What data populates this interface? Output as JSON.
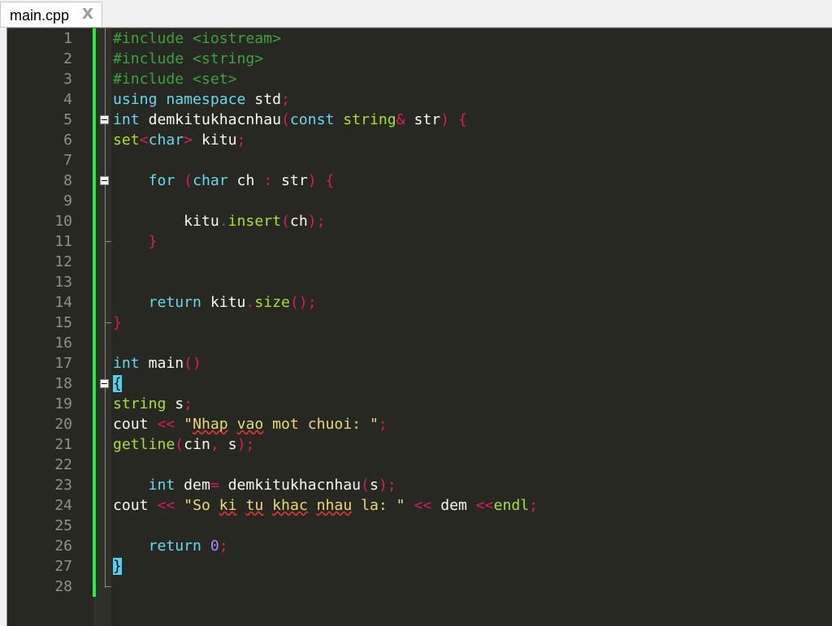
{
  "tab": {
    "title": "main.cpp",
    "close_glyph": "X"
  },
  "theme": {
    "background": "#272822",
    "line_number": "#8f908a",
    "change_bar": "#22ee44"
  },
  "lines": [
    {
      "n": "1",
      "tokens": [
        [
          "pre",
          "#include <iostream>"
        ]
      ]
    },
    {
      "n": "2",
      "tokens": [
        [
          "pre",
          "#include <string>"
        ]
      ]
    },
    {
      "n": "3",
      "tokens": [
        [
          "pre",
          "#include <set>"
        ]
      ]
    },
    {
      "n": "4",
      "tokens": [
        [
          "kw",
          "using namespace"
        ],
        [
          "id",
          " std"
        ],
        [
          "op",
          ";"
        ]
      ]
    },
    {
      "n": "5",
      "fold": true,
      "tokens": [
        [
          "kw",
          "int"
        ],
        [
          "id",
          " demkitukhacnhau"
        ],
        [
          "op",
          "("
        ],
        [
          "kw",
          "const"
        ],
        [
          "id",
          " "
        ],
        [
          "fn",
          "string"
        ],
        [
          "op",
          "&"
        ],
        [
          "id",
          " str"
        ],
        [
          "op",
          ")"
        ],
        [
          "id",
          " "
        ],
        [
          "op",
          "{"
        ]
      ]
    },
    {
      "n": "6",
      "tokens": [
        [
          "fn",
          "set"
        ],
        [
          "op",
          "<"
        ],
        [
          "kw",
          "char"
        ],
        [
          "op",
          ">"
        ],
        [
          "id",
          " kitu"
        ],
        [
          "op",
          ";"
        ]
      ]
    },
    {
      "n": "7",
      "tokens": []
    },
    {
      "n": "8",
      "fold": true,
      "tokens": [
        [
          "id",
          "    "
        ],
        [
          "kw",
          "for"
        ],
        [
          "id",
          " "
        ],
        [
          "op",
          "("
        ],
        [
          "kw",
          "char"
        ],
        [
          "id",
          " ch "
        ],
        [
          "op",
          ":"
        ],
        [
          "id",
          " str"
        ],
        [
          "op",
          ")"
        ],
        [
          "id",
          " "
        ],
        [
          "op",
          "{"
        ]
      ]
    },
    {
      "n": "9",
      "tokens": []
    },
    {
      "n": "10",
      "tokens": [
        [
          "id",
          "        kitu"
        ],
        [
          "op",
          "."
        ],
        [
          "fn",
          "insert"
        ],
        [
          "op",
          "("
        ],
        [
          "id",
          "ch"
        ],
        [
          "op",
          ")"
        ],
        [
          "op",
          ";"
        ]
      ]
    },
    {
      "n": "11",
      "foldend": true,
      "tokens": [
        [
          "id",
          "    "
        ],
        [
          "op",
          "}"
        ]
      ]
    },
    {
      "n": "12",
      "tokens": []
    },
    {
      "n": "13",
      "tokens": []
    },
    {
      "n": "14",
      "tokens": [
        [
          "id",
          "    "
        ],
        [
          "kw",
          "return"
        ],
        [
          "id",
          " kitu"
        ],
        [
          "op",
          "."
        ],
        [
          "fn",
          "size"
        ],
        [
          "op",
          "()"
        ],
        [
          "op",
          ";"
        ]
      ]
    },
    {
      "n": "15",
      "foldend": true,
      "tokens": [
        [
          "op",
          "}"
        ]
      ]
    },
    {
      "n": "16",
      "tokens": []
    },
    {
      "n": "17",
      "tokens": [
        [
          "kw",
          "int"
        ],
        [
          "id",
          " main"
        ],
        [
          "op",
          "()"
        ]
      ]
    },
    {
      "n": "18",
      "fold": true,
      "tokens": [
        [
          "brace",
          "{"
        ]
      ]
    },
    {
      "n": "19",
      "tokens": [
        [
          "fn",
          "string"
        ],
        [
          "id",
          " s"
        ],
        [
          "op",
          ";"
        ]
      ]
    },
    {
      "n": "20",
      "tokens": [
        [
          "id",
          "cout "
        ],
        [
          "op",
          "<<"
        ],
        [
          "id",
          " "
        ],
        [
          "str",
          "\""
        ],
        [
          "strsq",
          "Nhap"
        ],
        [
          "str",
          " "
        ],
        [
          "strsq",
          "vao"
        ],
        [
          "str",
          " mot chuoi: \""
        ],
        [
          "op",
          ";"
        ]
      ]
    },
    {
      "n": "21",
      "tokens": [
        [
          "fn",
          "getline"
        ],
        [
          "op",
          "("
        ],
        [
          "id",
          "cin"
        ],
        [
          "op",
          ","
        ],
        [
          "id",
          " s"
        ],
        [
          "op",
          ")"
        ],
        [
          "op",
          ";"
        ]
      ]
    },
    {
      "n": "22",
      "tokens": []
    },
    {
      "n": "23",
      "tokens": [
        [
          "id",
          "    "
        ],
        [
          "kw",
          "int"
        ],
        [
          "id",
          " dem"
        ],
        [
          "op",
          "="
        ],
        [
          "id",
          " demkitukhacnhau"
        ],
        [
          "op",
          "("
        ],
        [
          "id",
          "s"
        ],
        [
          "op",
          ")"
        ],
        [
          "op",
          ";"
        ]
      ]
    },
    {
      "n": "24",
      "tokens": [
        [
          "id",
          "cout "
        ],
        [
          "op",
          "<<"
        ],
        [
          "id",
          " "
        ],
        [
          "str",
          "\"So "
        ],
        [
          "strsq",
          "ki"
        ],
        [
          "str",
          " "
        ],
        [
          "strsq",
          "tu"
        ],
        [
          "str",
          " "
        ],
        [
          "strsq",
          "khac"
        ],
        [
          "str",
          " "
        ],
        [
          "strsq",
          "nhau"
        ],
        [
          "str",
          " la: \""
        ],
        [
          "id",
          " "
        ],
        [
          "op",
          "<<"
        ],
        [
          "id",
          " dem "
        ],
        [
          "op",
          "<<"
        ],
        [
          "fn",
          "endl"
        ],
        [
          "op",
          ";"
        ]
      ]
    },
    {
      "n": "25",
      "tokens": []
    },
    {
      "n": "26",
      "tokens": [
        [
          "id",
          "    "
        ],
        [
          "kw",
          "return"
        ],
        [
          "id",
          " "
        ],
        [
          "num",
          "0"
        ],
        [
          "op",
          ";"
        ]
      ]
    },
    {
      "n": "27",
      "tokens": [
        [
          "brace",
          "}"
        ]
      ]
    },
    {
      "n": "28",
      "foldend": true,
      "tokens": []
    }
  ]
}
